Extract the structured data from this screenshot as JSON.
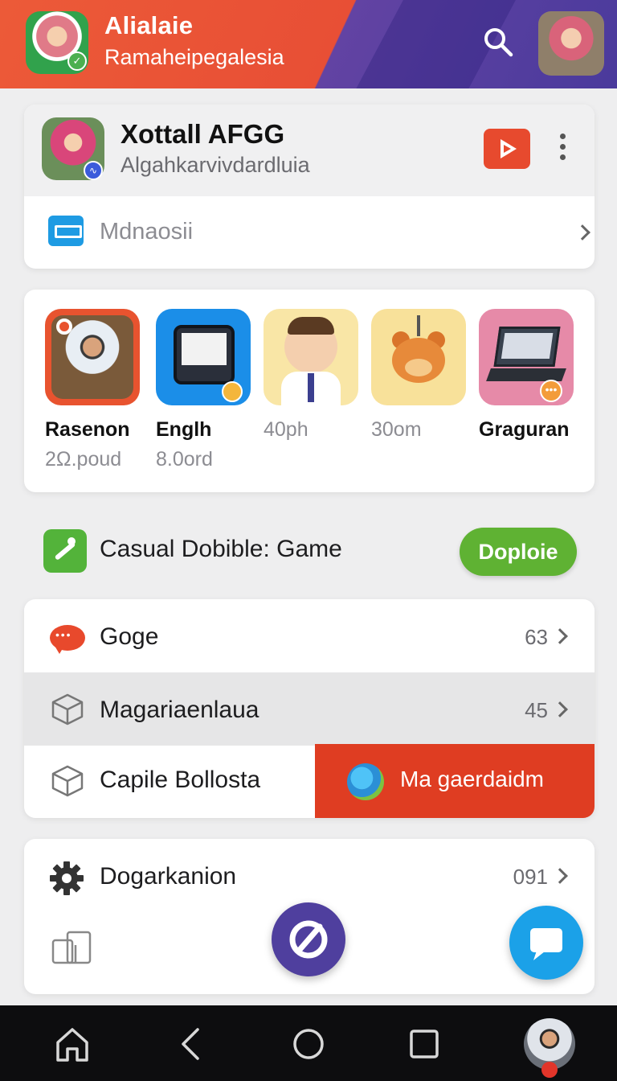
{
  "header": {
    "title": "Alialaie",
    "subtitle": "Ramaheipegalesia",
    "search_icon": "search-icon",
    "colors": {
      "primary": "#ec5a38",
      "secondary": "#4a3a9c"
    }
  },
  "profile_card": {
    "channel_name": "Xottall AFGG",
    "channel_sub": "Algahkarvivdardluia",
    "message_label": "Mdnaosii"
  },
  "apps": [
    {
      "name": "Rasenon",
      "meta": "2Ω.poud"
    },
    {
      "name": "Englh",
      "meta": "8.0ord"
    },
    {
      "name": "40ph",
      "meta": ""
    },
    {
      "name": "30om",
      "meta": ""
    },
    {
      "name": "Graguran",
      "meta": ""
    }
  ],
  "game_row": {
    "label": "Casual Dobible: Game",
    "button": "Doploie",
    "button_color": "#5fb233"
  },
  "list": {
    "items": [
      {
        "label": "Goge",
        "count": "63"
      },
      {
        "label": "Magariaenlaua",
        "count": "45"
      },
      {
        "label": "Capile Bollosta"
      }
    ],
    "highlight_button": "Ma gaerdaidm",
    "highlight_color": "#df3d22"
  },
  "settings": {
    "label": "Dogarkanion",
    "count": "091"
  }
}
